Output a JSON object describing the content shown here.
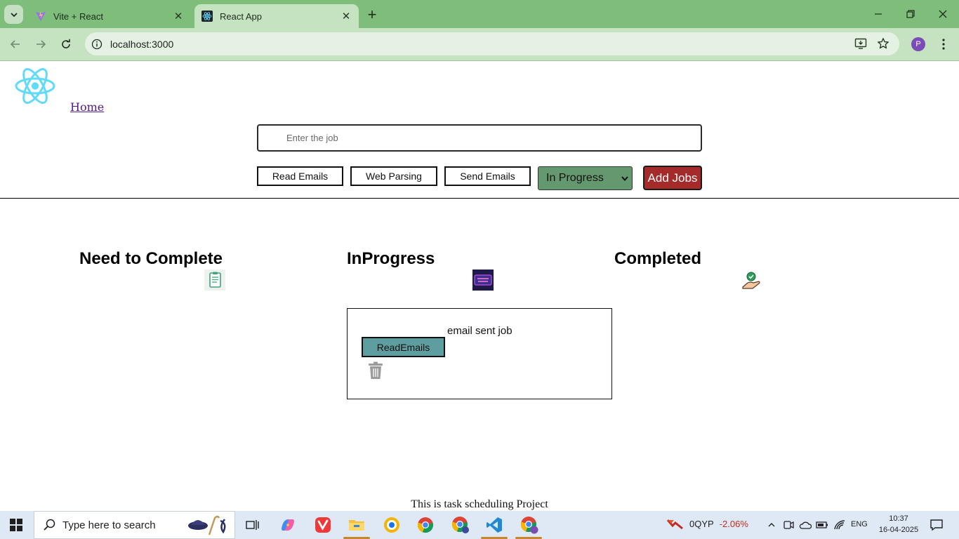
{
  "browser": {
    "tabs": [
      {
        "title": "Vite + React",
        "active": false
      },
      {
        "title": "React App",
        "active": true
      }
    ],
    "url": "localhost:3000",
    "profile_initial": "P",
    "accent_color": "#7ebd7a"
  },
  "page": {
    "nav": {
      "home_label": "Home"
    },
    "job_input": {
      "placeholder": "Enter the job",
      "value": ""
    },
    "tag_buttons": [
      {
        "label": "Read Emails"
      },
      {
        "label": "Web Parsing"
      },
      {
        "label": "Send Emails"
      }
    ],
    "status_select": {
      "selected": "In Progress",
      "color": "#64996f"
    },
    "add_button": {
      "label": "Add Jobs",
      "color": "#a52a2a"
    },
    "columns": [
      {
        "title": "Need to Complete",
        "icon": "clipboard-icon"
      },
      {
        "title": "InProgress",
        "icon": "work-in-progress-icon"
      },
      {
        "title": "Completed",
        "icon": "hand-check-icon"
      }
    ],
    "cards": [
      {
        "column": "InProgress",
        "title": "email sent job",
        "tag": "ReadEmails",
        "tag_color": "#5f9ea0",
        "action_icon": "trash-icon"
      }
    ],
    "footer": "This is task scheduling Project"
  },
  "taskbar": {
    "search_placeholder": "Type here to search",
    "stock": {
      "name": "0QYP",
      "change": "-2.06%"
    },
    "language": "ENG",
    "time": "10:37",
    "date": "16-04-2025"
  }
}
